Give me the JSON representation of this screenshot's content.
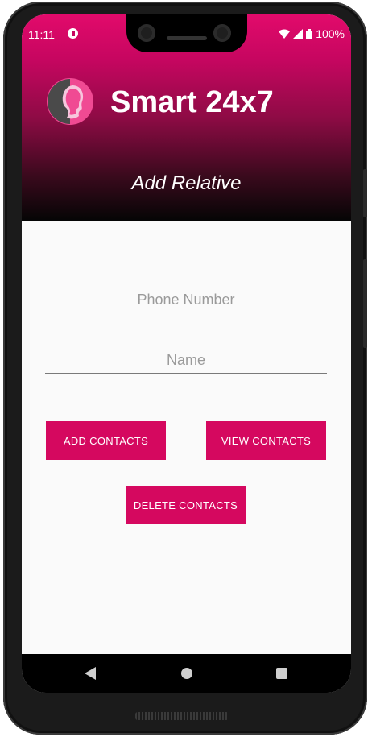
{
  "status_bar": {
    "time": "11:11",
    "battery": "100%"
  },
  "header": {
    "app_title": "Smart 24x7",
    "subtitle": "Add Relative"
  },
  "form": {
    "phone_placeholder": "Phone Number",
    "name_placeholder": "Name"
  },
  "buttons": {
    "add_contacts": "ADD CONTACTS",
    "view_contacts": "VIEW CONTACTS",
    "delete_contacts": "DELETE CONTACTS"
  },
  "colors": {
    "accent": "#d5085f",
    "header_top": "#e20a6b",
    "header_bottom": "#050505",
    "background": "#fafafa"
  },
  "icons": {
    "logo": "woman-profile-logo",
    "nav": [
      "back-icon",
      "home-icon",
      "recents-icon"
    ]
  }
}
